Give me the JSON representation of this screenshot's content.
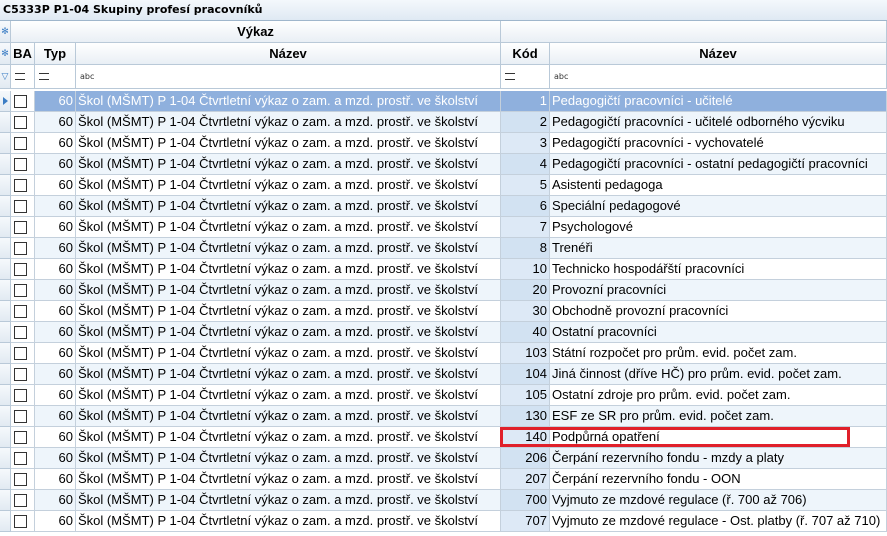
{
  "window": {
    "title": "C5333P P1-04 Skupiny profesí pracovníků"
  },
  "header": {
    "group_left": "Výkaz",
    "columns": {
      "ba": "BA",
      "typ": "Typ",
      "nazev1": "Název",
      "kod": "Kód",
      "nazev2": "Název"
    },
    "filter": {
      "abc1": "abc",
      "abc2": "abc"
    }
  },
  "rows": [
    {
      "typ": "60",
      "vykaz": "Škol (MŠMT)  P 1-04 Čtvrtletní výkaz o zam. a mzd. prostř. ve školství",
      "kod": "1",
      "nazev": "Pedagogičtí pracovníci - učitelé"
    },
    {
      "typ": "60",
      "vykaz": "Škol (MŠMT)  P 1-04 Čtvrtletní výkaz o zam. a mzd. prostř. ve školství",
      "kod": "2",
      "nazev": "Pedagogičtí pracovníci - učitelé odborného výcviku"
    },
    {
      "typ": "60",
      "vykaz": "Škol (MŠMT)  P 1-04 Čtvrtletní výkaz o zam. a mzd. prostř. ve školství",
      "kod": "3",
      "nazev": "Pedagogičtí pracovníci - vychovatelé"
    },
    {
      "typ": "60",
      "vykaz": "Škol (MŠMT)  P 1-04 Čtvrtletní výkaz o zam. a mzd. prostř. ve školství",
      "kod": "4",
      "nazev": "Pedagogičtí pracovníci - ostatní pedagogičtí pracovníci"
    },
    {
      "typ": "60",
      "vykaz": "Škol (MŠMT)  P 1-04 Čtvrtletní výkaz o zam. a mzd. prostř. ve školství",
      "kod": "5",
      "nazev": "Asistenti pedagoga"
    },
    {
      "typ": "60",
      "vykaz": "Škol (MŠMT)  P 1-04 Čtvrtletní výkaz o zam. a mzd. prostř. ve školství",
      "kod": "6",
      "nazev": "Speciální pedagogové"
    },
    {
      "typ": "60",
      "vykaz": "Škol (MŠMT)  P 1-04 Čtvrtletní výkaz o zam. a mzd. prostř. ve školství",
      "kod": "7",
      "nazev": "Psychologové"
    },
    {
      "typ": "60",
      "vykaz": "Škol (MŠMT)  P 1-04 Čtvrtletní výkaz o zam. a mzd. prostř. ve školství",
      "kod": "8",
      "nazev": "Trenéři"
    },
    {
      "typ": "60",
      "vykaz": "Škol (MŠMT)  P 1-04 Čtvrtletní výkaz o zam. a mzd. prostř. ve školství",
      "kod": "10",
      "nazev": "Technicko hospodářští pracovníci"
    },
    {
      "typ": "60",
      "vykaz": "Škol (MŠMT)  P 1-04 Čtvrtletní výkaz o zam. a mzd. prostř. ve školství",
      "kod": "20",
      "nazev": "Provozní pracovníci"
    },
    {
      "typ": "60",
      "vykaz": "Škol (MŠMT)  P 1-04 Čtvrtletní výkaz o zam. a mzd. prostř. ve školství",
      "kod": "30",
      "nazev": "Obchodně provozní pracovníci"
    },
    {
      "typ": "60",
      "vykaz": "Škol (MŠMT)  P 1-04 Čtvrtletní výkaz o zam. a mzd. prostř. ve školství",
      "kod": "40",
      "nazev": "Ostatní pracovníci"
    },
    {
      "typ": "60",
      "vykaz": "Škol (MŠMT)  P 1-04 Čtvrtletní výkaz o zam. a mzd. prostř. ve školství",
      "kod": "103",
      "nazev": "Státní rozpočet pro prům. evid. počet zam."
    },
    {
      "typ": "60",
      "vykaz": "Škol (MŠMT)  P 1-04 Čtvrtletní výkaz o zam. a mzd. prostř. ve školství",
      "kod": "104",
      "nazev": "Jiná činnost (dříve HČ) pro prům. evid. počet zam."
    },
    {
      "typ": "60",
      "vykaz": "Škol (MŠMT)  P 1-04 Čtvrtletní výkaz o zam. a mzd. prostř. ve školství",
      "kod": "105",
      "nazev": "Ostatní zdroje pro prům. evid. počet zam."
    },
    {
      "typ": "60",
      "vykaz": "Škol (MŠMT)  P 1-04 Čtvrtletní výkaz o zam. a mzd. prostř. ve školství",
      "kod": "130",
      "nazev": "ESF ze SR pro prům. evid. počet zam."
    },
    {
      "typ": "60",
      "vykaz": "Škol (MŠMT)  P 1-04 Čtvrtletní výkaz o zam. a mzd. prostř. ve školství",
      "kod": "140",
      "nazev": "Podpůrná opatření"
    },
    {
      "typ": "60",
      "vykaz": "Škol (MŠMT)  P 1-04 Čtvrtletní výkaz o zam. a mzd. prostř. ve školství",
      "kod": "206",
      "nazev": "Čerpání rezervního fondu - mzdy a platy"
    },
    {
      "typ": "60",
      "vykaz": "Škol (MŠMT)  P 1-04 Čtvrtletní výkaz o zam. a mzd. prostř. ve školství",
      "kod": "207",
      "nazev": "Čerpání rezervního fondu - OON"
    },
    {
      "typ": "60",
      "vykaz": "Škol (MŠMT)  P 1-04 Čtvrtletní výkaz o zam. a mzd. prostř. ve školství",
      "kod": "700",
      "nazev": "Vyjmuto ze mzdové regulace (ř. 700 až 706)"
    },
    {
      "typ": "60",
      "vykaz": "Škol (MŠMT)  P 1-04 Čtvrtletní výkaz o zam. a mzd. prostř. ve školství",
      "kod": "707",
      "nazev": "Vyjmuto ze mzdové regulace - Ost. platby (ř. 707 až 710)"
    }
  ],
  "selected_row": 0,
  "highlighted_row": 16,
  "colors": {
    "selection": "#8fb0dd",
    "highlight_box": "#e0202a",
    "alt_row": "#eef5fb"
  }
}
